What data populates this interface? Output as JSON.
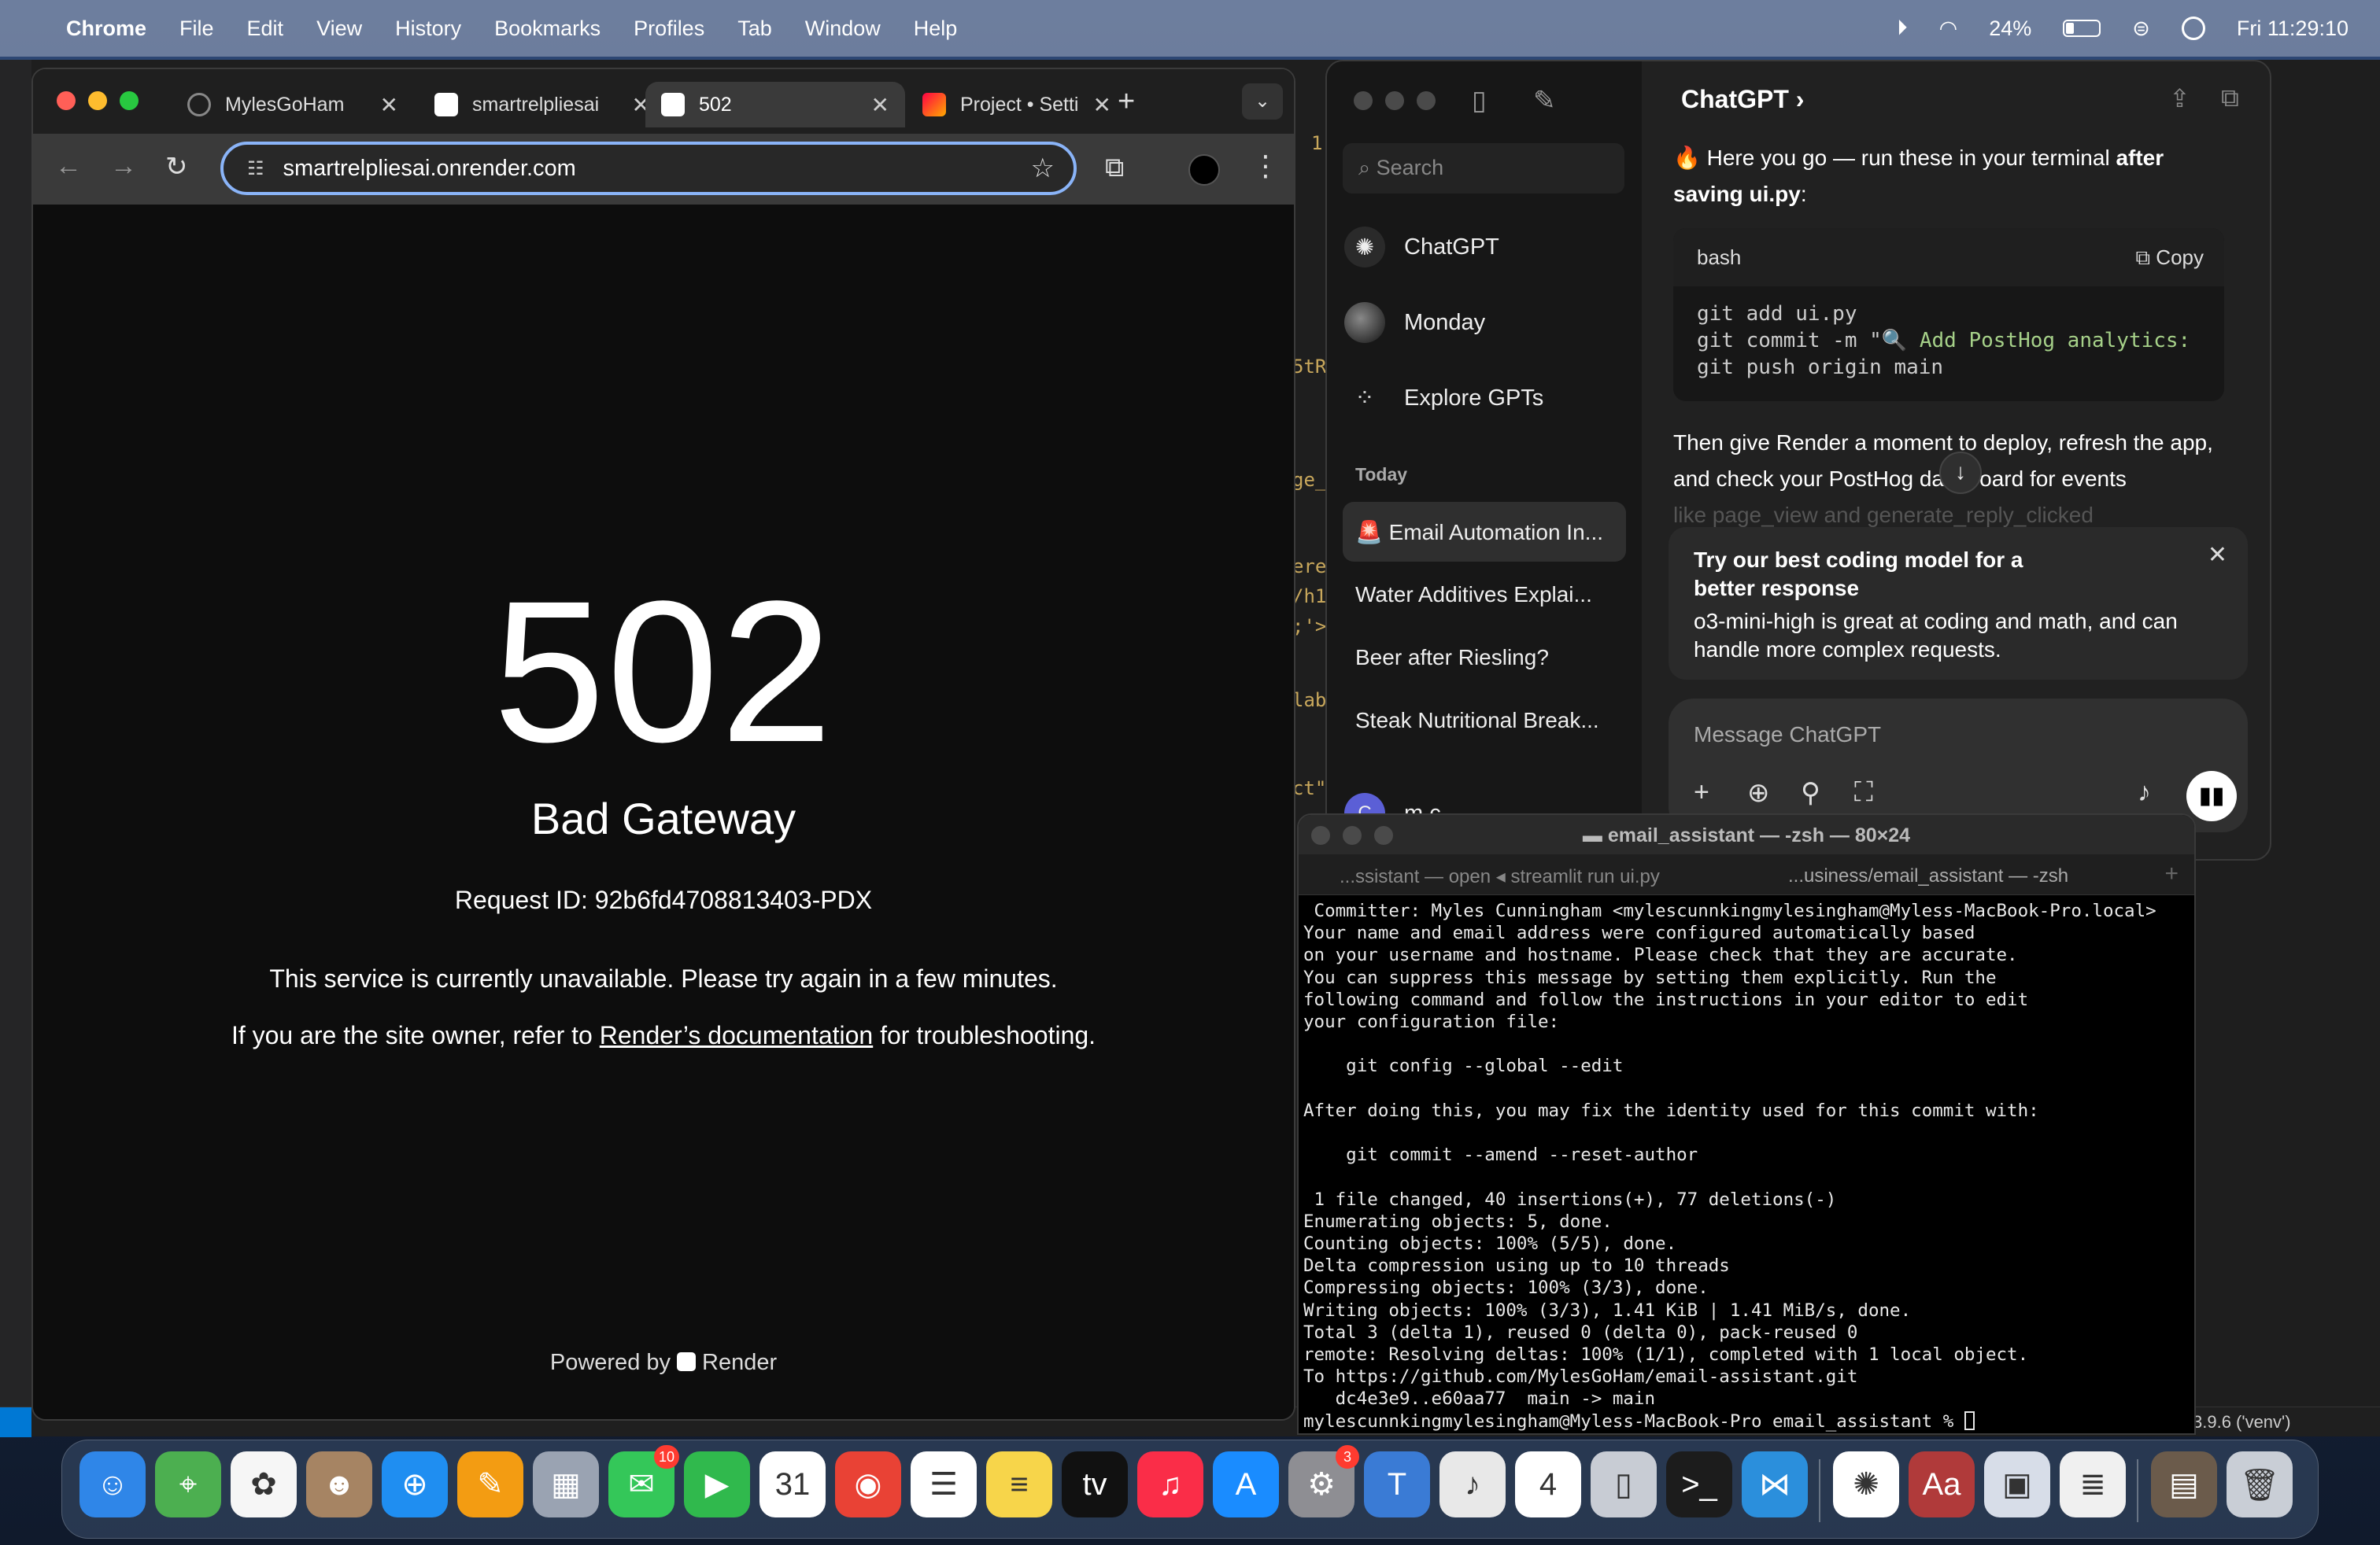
{
  "menubar": {
    "app_name": "Chrome",
    "menus": [
      "File",
      "Edit",
      "View",
      "History",
      "Bookmarks",
      "Profiles",
      "Tab",
      "Window",
      "Help"
    ],
    "battery_percent": "24%",
    "battery_level": 0.24,
    "datetime": "Fri 11:29:10"
  },
  "chrome": {
    "tabs": [
      {
        "title": "MylesGoHam",
        "active": false
      },
      {
        "title": "smartrelpliesai",
        "active": false
      },
      {
        "title": "502",
        "active": true
      },
      {
        "title": "Project • Setti",
        "active": false
      }
    ],
    "url": "smartrelpliesai.onrender.com",
    "page": {
      "code": "502",
      "title": "Bad Gateway",
      "request_id": "Request ID: 92b6fd4708813403-PDX",
      "message": "This service is currently unavailable. Please try again in a few minutes.",
      "owner_prefix": "If you are the site owner, refer to ",
      "owner_link": "Render’s documentation",
      "owner_suffix": " for troubleshooting.",
      "powered_prefix": "Powered by",
      "powered_brand": "Render"
    }
  },
  "chatgpt": {
    "window_title": "ChatGPT",
    "search_placeholder": "Search",
    "nav": [
      {
        "label": "ChatGPT"
      },
      {
        "label": "Monday"
      },
      {
        "label": "Explore GPTs"
      }
    ],
    "section_today": "Today",
    "chats": [
      "🚨 Email Automation In...",
      "Water Additives Explai...",
      "Beer after Riesling?",
      "Steak Nutritional Break..."
    ],
    "user_initial": "C",
    "user_name": "m c",
    "message_intro_prefix": "🔥 Here you go — run these in your terminal ",
    "message_intro_bold": "after saving ui.py",
    "message_intro_suffix": ":",
    "code_lang": "bash",
    "code_copy": "Copy",
    "code_line1": "git add ui.py",
    "code_line2_cmd": "git commit -m \"",
    "code_line2_str": "🔍 Add PostHog analytics:",
    "code_line3": "git push origin main",
    "message_followup": "Then give Render a moment to deploy, refresh the app, and check your PostHog dashboard for events",
    "message_fade": "like page_view and generate_reply_clicked",
    "promo_title": "Try our best coding model for a better response",
    "promo_body": "o3-mini-high is great at coding and math, and can handle more complex requests.",
    "composer_placeholder": "Message ChatGPT"
  },
  "terminal": {
    "title": "email_assistant — -zsh — 80×24",
    "tabs": [
      "...ssistant — open ◂ streamlit run ui.py",
      "...usiness/email_assistant — -zsh"
    ],
    "lines": [
      " Committer: Myles Cunningham <mylescunnkingmylesingham@Myless-MacBook-Pro.local>",
      "Your name and email address were configured automatically based",
      "on your username and hostname. Please check that they are accurate.",
      "You can suppress this message by setting them explicitly. Run the",
      "following command and follow the instructions in your editor to edit",
      "your configuration file:",
      "",
      "    git config --global --edit",
      "",
      "After doing this, you may fix the identity used for this commit with:",
      "",
      "    git commit --amend --reset-author",
      "",
      " 1 file changed, 40 insertions(+), 77 deletions(-)",
      "Enumerating objects: 5, done.",
      "Counting objects: 100% (5/5), done.",
      "Delta compression using up to 10 threads",
      "Compressing objects: 100% (3/3), done.",
      "Writing objects: 100% (3/3), 1.41 KiB | 1.41 MiB/s, done.",
      "Total 3 (delta 1), reused 0 (delta 0), pack-reused 0",
      "remote: Resolving deltas: 100% (1/1), completed with 1 local object.",
      "To https://github.com/MylesGoHam/email-assistant.git",
      "   dc4e3e9..e60aa77  main -> main",
      "mylescunnkingmylesingham@Myless-MacBook-Pro email_assistant % "
    ]
  },
  "editor": {
    "snippets": [
      "1",
      "5tR",
      "ge_",
      "ere",
      "/h1",
      ";'>",
      "lab",
      "ct\""
    ],
    "status_venv": "3.9.6 ('venv')"
  },
  "dock": {
    "apps": [
      {
        "name": "finder-icon",
        "glyph": "☺",
        "color": "#2f86e8"
      },
      {
        "name": "maps-icon",
        "glyph": "⌖",
        "color": "#4caf50"
      },
      {
        "name": "photos-icon",
        "glyph": "✿",
        "color": "#f6f6f6"
      },
      {
        "name": "contacts-icon",
        "glyph": "☻",
        "color": "#a68463"
      },
      {
        "name": "safari-icon",
        "glyph": "⊕",
        "color": "#1f8ef1"
      },
      {
        "name": "pages-icon",
        "glyph": "✎",
        "color": "#f39c12"
      },
      {
        "name": "launchpad-icon",
        "glyph": "▦",
        "color": "#9aa3b2"
      },
      {
        "name": "messages-icon",
        "glyph": "✉",
        "color": "#34c759",
        "badge": "10"
      },
      {
        "name": "facetime-icon",
        "glyph": "▶",
        "color": "#30b94d"
      },
      {
        "name": "calendar-icon",
        "glyph": "31",
        "color": "#ffffff"
      },
      {
        "name": "chrome-icon",
        "glyph": "◉",
        "color": "#e94235"
      },
      {
        "name": "reminders-icon",
        "glyph": "☰",
        "color": "#ffffff"
      },
      {
        "name": "notes-icon",
        "glyph": "≡",
        "color": "#f7d54a"
      },
      {
        "name": "tv-icon",
        "glyph": "tv",
        "color": "#111111"
      },
      {
        "name": "music-icon",
        "glyph": "♫",
        "color": "#fa2d48"
      },
      {
        "name": "app-store-icon",
        "glyph": "A",
        "color": "#1a8cff"
      },
      {
        "name": "system-settings-icon",
        "glyph": "⚙",
        "color": "#8e8e93",
        "badge": "3"
      },
      {
        "name": "tai-lopez-icon",
        "glyph": "T",
        "color": "#3a7bd5"
      },
      {
        "name": "keynote-icon",
        "glyph": "♪",
        "color": "#e8e8e8"
      },
      {
        "name": "calendar-apr-icon",
        "glyph": "4",
        "color": "#ffffff"
      },
      {
        "name": "iphone-mirroring-icon",
        "glyph": "▯",
        "color": "#c8ccd4"
      },
      {
        "name": "terminal-icon",
        "glyph": ">_",
        "color": "#1c1c1c"
      },
      {
        "name": "vscode-icon",
        "glyph": "⋈",
        "color": "#2b8fdc"
      },
      {
        "name": "chatgpt-icon",
        "glyph": "✺",
        "color": "#ffffff"
      },
      {
        "name": "dictionary-icon",
        "glyph": "Aa",
        "color": "#b03a3a"
      },
      {
        "name": "preview-icon",
        "glyph": "▣",
        "color": "#d7dde8"
      },
      {
        "name": "text-file-icon",
        "glyph": "≣",
        "color": "#f0f0f0"
      },
      {
        "name": "image-stack-icon",
        "glyph": "▤",
        "color": "#6b5b4b"
      },
      {
        "name": "trash-icon",
        "glyph": "🗑",
        "color": "#c9ced6"
      }
    ]
  },
  "colors": {
    "chrome_accent": "#8ab4f8",
    "render_bg": "#0d0d0d",
    "chatgpt_bg": "#212121"
  }
}
